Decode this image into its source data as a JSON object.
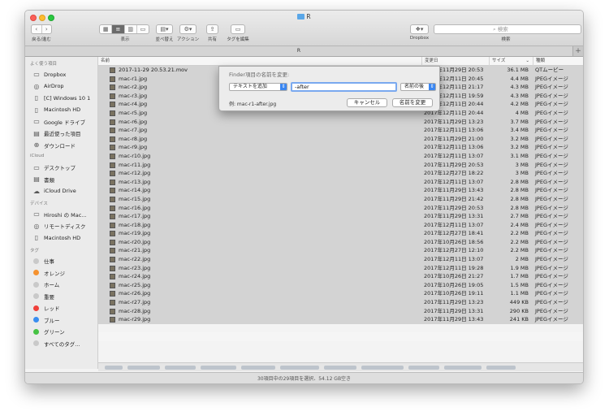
{
  "window": {
    "title": "R"
  },
  "toolbar": {
    "back_forward_label": "戻る/進む",
    "view_label": "表示",
    "arrange_label": "並べ替え",
    "action_label": "アクション",
    "share_label": "共有",
    "tag_edit_label": "タグを編集",
    "dropbox_label": "Dropbox",
    "search_label": "検索",
    "search_placeholder": "検索"
  },
  "tabbar": {
    "tab_label": "R",
    "add_label": "+"
  },
  "sidebar": {
    "favorites_header": "よく使う項目",
    "favorites": [
      {
        "label": "Dropbox",
        "icon": "folder-icon"
      },
      {
        "label": "AirDrop",
        "icon": "airdrop-icon"
      },
      {
        "label": "[C] Windows 10 1",
        "icon": "document-icon"
      },
      {
        "label": "Macintosh HD",
        "icon": "document-icon"
      },
      {
        "label": "Google ドライブ",
        "icon": "folder-icon"
      },
      {
        "label": "最近使った項目",
        "icon": "recents-icon"
      },
      {
        "label": "ダウンロード",
        "icon": "download-icon"
      }
    ],
    "icloud_header": "iCloud",
    "icloud": [
      {
        "label": "デスクトップ",
        "icon": "desktop-icon"
      },
      {
        "label": "書類",
        "icon": "documents-icon"
      },
      {
        "label": "iCloud Drive",
        "icon": "cloud-icon"
      }
    ],
    "devices_header": "デバイス",
    "devices": [
      {
        "label": "Hiroshi の Mac...",
        "icon": "computer-icon"
      },
      {
        "label": "リモートディスク",
        "icon": "disc-icon"
      },
      {
        "label": "Macintosh HD",
        "icon": "drive-icon"
      }
    ],
    "tags_header": "タグ",
    "tags": [
      {
        "label": "仕事",
        "color": "#c9c9c9"
      },
      {
        "label": "オレンジ",
        "color": "#f5922f"
      },
      {
        "label": "ホーム",
        "color": "#c9c9c9"
      },
      {
        "label": "重要",
        "color": "#c9c9c9"
      },
      {
        "label": "レッド",
        "color": "#f0403a"
      },
      {
        "label": "ブルー",
        "color": "#3a8ef0"
      },
      {
        "label": "グリーン",
        "color": "#46c244"
      },
      {
        "label": "すべてのタグ...",
        "color": "#c9c9c9"
      }
    ]
  },
  "list": {
    "columns": {
      "name": "名前",
      "date": "変更日",
      "size": "サイズ",
      "kind": "種類"
    },
    "rows": [
      {
        "name": "2017-11-29 20.53.21.mov",
        "date": "2017年11月29日 20:53",
        "size": "36.1 MB",
        "kind": "QTムービー"
      },
      {
        "name": "mac-r1.jpg",
        "date": "2017年12月11日 20:45",
        "size": "4.4 MB",
        "kind": "JPEGイメージ"
      },
      {
        "name": "mac-r2.jpg",
        "date": "2017年12月11日 21:17",
        "size": "4.3 MB",
        "kind": "JPEGイメージ"
      },
      {
        "name": "mac-r3.jpg",
        "date": "2017年12月11日 19:59",
        "size": "4.3 MB",
        "kind": "JPEGイメージ"
      },
      {
        "name": "mac-r4.jpg",
        "date": "2017年12月11日 20:44",
        "size": "4.2 MB",
        "kind": "JPEGイメージ"
      },
      {
        "name": "mac-r5.jpg",
        "date": "2017年12月11日 20:44",
        "size": "4 MB",
        "kind": "JPEGイメージ"
      },
      {
        "name": "mac-r6.jpg",
        "date": "2017年11月29日 13:23",
        "size": "3.7 MB",
        "kind": "JPEGイメージ"
      },
      {
        "name": "mac-r7.jpg",
        "date": "2017年12月11日 13:06",
        "size": "3.4 MB",
        "kind": "JPEGイメージ"
      },
      {
        "name": "mac-r8.jpg",
        "date": "2017年11月29日 21:00",
        "size": "3.2 MB",
        "kind": "JPEGイメージ"
      },
      {
        "name": "mac-r9.jpg",
        "date": "2017年12月11日 13:06",
        "size": "3.2 MB",
        "kind": "JPEGイメージ"
      },
      {
        "name": "mac-r10.jpg",
        "date": "2017年12月11日 13:07",
        "size": "3.1 MB",
        "kind": "JPEGイメージ"
      },
      {
        "name": "mac-r11.jpg",
        "date": "2017年11月29日 20:53",
        "size": "3 MB",
        "kind": "JPEGイメージ"
      },
      {
        "name": "mac-r12.jpg",
        "date": "2017年12月27日 18:22",
        "size": "3 MB",
        "kind": "JPEGイメージ"
      },
      {
        "name": "mac-r13.jpg",
        "date": "2017年12月11日 13:07",
        "size": "2.8 MB",
        "kind": "JPEGイメージ"
      },
      {
        "name": "mac-r14.jpg",
        "date": "2017年11月29日 13:43",
        "size": "2.8 MB",
        "kind": "JPEGイメージ"
      },
      {
        "name": "mac-r15.jpg",
        "date": "2017年11月29日 21:42",
        "size": "2.8 MB",
        "kind": "JPEGイメージ"
      },
      {
        "name": "mac-r16.jpg",
        "date": "2017年11月29日 20:53",
        "size": "2.8 MB",
        "kind": "JPEGイメージ"
      },
      {
        "name": "mac-r17.jpg",
        "date": "2017年11月29日 13:31",
        "size": "2.7 MB",
        "kind": "JPEGイメージ"
      },
      {
        "name": "mac-r18.jpg",
        "date": "2017年12月11日 13:07",
        "size": "2.4 MB",
        "kind": "JPEGイメージ"
      },
      {
        "name": "mac-r19.jpg",
        "date": "2017年12月27日 18:41",
        "size": "2.2 MB",
        "kind": "JPEGイメージ"
      },
      {
        "name": "mac-r20.jpg",
        "date": "2017年10月26日 18:56",
        "size": "2.2 MB",
        "kind": "JPEGイメージ"
      },
      {
        "name": "mac-r21.jpg",
        "date": "2017年12月27日 12:10",
        "size": "2.2 MB",
        "kind": "JPEGイメージ"
      },
      {
        "name": "mac-r22.jpg",
        "date": "2017年12月11日 13:07",
        "size": "2 MB",
        "kind": "JPEGイメージ"
      },
      {
        "name": "mac-r23.jpg",
        "date": "2017年12月11日 19:28",
        "size": "1.9 MB",
        "kind": "JPEGイメージ"
      },
      {
        "name": "mac-r24.jpg",
        "date": "2017年10月26日 21:27",
        "size": "1.7 MB",
        "kind": "JPEGイメージ"
      },
      {
        "name": "mac-r25.jpg",
        "date": "2017年10月26日 19:05",
        "size": "1.5 MB",
        "kind": "JPEGイメージ"
      },
      {
        "name": "mac-r26.jpg",
        "date": "2017年10月26日 19:11",
        "size": "1.1 MB",
        "kind": "JPEGイメージ"
      },
      {
        "name": "mac-r27.jpg",
        "date": "2017年11月29日 13:23",
        "size": "449 KB",
        "kind": "JPEGイメージ"
      },
      {
        "name": "mac-r28.jpg",
        "date": "2017年11月29日 13:31",
        "size": "290 KB",
        "kind": "JPEGイメージ"
      },
      {
        "name": "mac-r29.jpg",
        "date": "2017年11月29日 13:43",
        "size": "241 KB",
        "kind": "JPEGイメージ"
      }
    ]
  },
  "dialog": {
    "title": "Finder項目の名前を変更:",
    "format_select": "テキストを追加",
    "text_value": "-after",
    "position_select": "名前の後",
    "example": "例: mac-r1-after.jpg",
    "cancel_label": "キャンセル",
    "rename_label": "名前を変更"
  },
  "status": {
    "text": "30項目中の29項目を選択、54.12 GB空き"
  }
}
